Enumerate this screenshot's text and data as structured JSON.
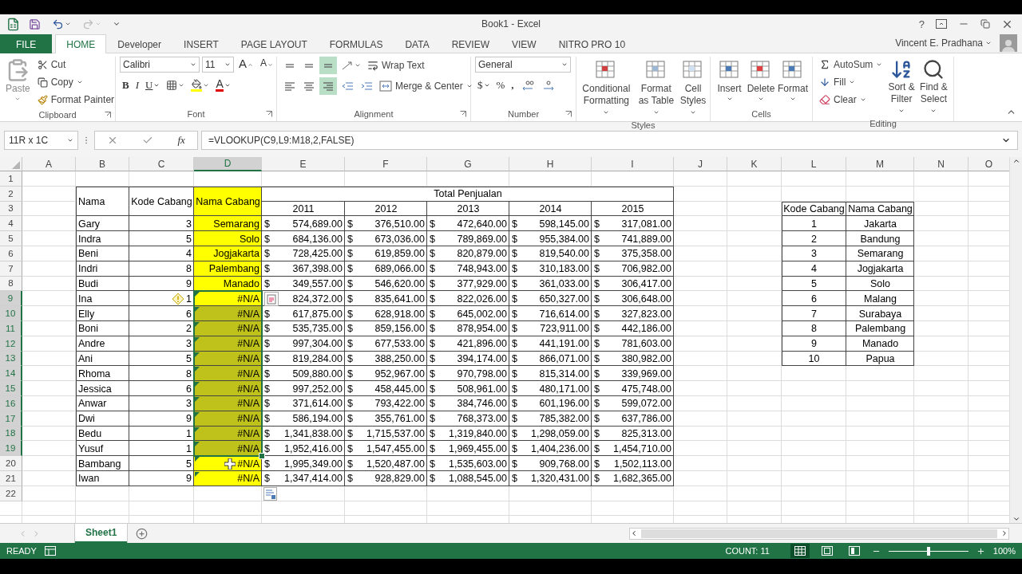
{
  "title_bar": {
    "title": "Book1 - Excel",
    "help": "?"
  },
  "ribbon_tabs": [
    {
      "label": "FILE",
      "kind": "file",
      "selected": false
    },
    {
      "label": "HOME",
      "kind": "tab",
      "selected": true
    },
    {
      "label": "Developer",
      "kind": "tab",
      "selected": false
    },
    {
      "label": "INSERT",
      "kind": "tab",
      "selected": false
    },
    {
      "label": "PAGE LAYOUT",
      "kind": "tab",
      "selected": false
    },
    {
      "label": "FORMULAS",
      "kind": "tab",
      "selected": false
    },
    {
      "label": "DATA",
      "kind": "tab",
      "selected": false
    },
    {
      "label": "REVIEW",
      "kind": "tab",
      "selected": false
    },
    {
      "label": "VIEW",
      "kind": "tab",
      "selected": false
    },
    {
      "label": "NITRO PRO 10",
      "kind": "tab",
      "selected": false
    }
  ],
  "account": {
    "name": "Vincent E. Pradhana"
  },
  "ribbon_groups": [
    {
      "kind": "clipboard",
      "label": "Clipboard",
      "items": [
        "Paste",
        "Cut",
        "Copy",
        "Format Painter"
      ]
    },
    {
      "kind": "font",
      "label": "Font",
      "font": "Calibri",
      "size": "11",
      "size_buttons": [
        "A",
        "A"
      ],
      "styles": [
        "B",
        "I",
        "U"
      ],
      "color_letter": "A"
    },
    {
      "kind": "alignment",
      "label": "Alignment",
      "items": [
        "Wrap Text",
        "Merge & Center"
      ],
      "vertical": [
        {
          "selected": false
        },
        {
          "selected": false
        },
        {
          "selected": true
        }
      ],
      "horizontal": [
        {
          "selected": false
        },
        {
          "selected": false
        },
        {
          "selected": true
        }
      ]
    },
    {
      "kind": "number",
      "label": "Number",
      "format": "General",
      "symbols": [
        "$",
        "%",
        ","
      ]
    },
    {
      "kind": "styles",
      "label": "Styles",
      "items": [
        "Conditional Formatting",
        "Format as Table",
        "Cell Styles"
      ]
    },
    {
      "kind": "cells",
      "label": "Cells",
      "items": [
        "Insert",
        "Delete",
        "Format"
      ]
    },
    {
      "kind": "editing",
      "label": "Editing",
      "items": [
        "AutoSum",
        "Fill",
        "Clear",
        "Sort & Filter",
        "Find & Select"
      ]
    }
  ],
  "formula_bar": {
    "name_box": "11R x 1C",
    "function_label": "fx",
    "formula": "=VLOOKUP(C9,L9:M18,2,FALSE)"
  },
  "columns": [
    {
      "label": "A",
      "selected": false
    },
    {
      "label": "B",
      "selected": false
    },
    {
      "label": "C",
      "selected": false
    },
    {
      "label": "D",
      "selected": true
    },
    {
      "label": "E",
      "selected": false
    },
    {
      "label": "F",
      "selected": false
    },
    {
      "label": "G",
      "selected": false
    },
    {
      "label": "H",
      "selected": false
    },
    {
      "label": "I",
      "selected": false
    },
    {
      "label": "J",
      "selected": false
    },
    {
      "label": "K",
      "selected": false
    },
    {
      "label": "L",
      "selected": false
    },
    {
      "label": "M",
      "selected": false
    },
    {
      "label": "N",
      "selected": false
    },
    {
      "label": "O",
      "selected": false
    }
  ],
  "row_headers": [
    {
      "label": "1",
      "selected": false
    },
    {
      "label": "2",
      "selected": false
    },
    {
      "label": "3",
      "selected": false
    },
    {
      "label": "4",
      "selected": false
    },
    {
      "label": "5",
      "selected": false
    },
    {
      "label": "6",
      "selected": false
    },
    {
      "label": "7",
      "selected": false
    },
    {
      "label": "8",
      "selected": false
    },
    {
      "label": "9",
      "selected": true
    },
    {
      "label": "10",
      "selected": true
    },
    {
      "label": "11",
      "selected": true
    },
    {
      "label": "12",
      "selected": true
    },
    {
      "label": "13",
      "selected": true
    },
    {
      "label": "14",
      "selected": true
    },
    {
      "label": "15",
      "selected": true
    },
    {
      "label": "16",
      "selected": true
    },
    {
      "label": "17",
      "selected": true
    },
    {
      "label": "18",
      "selected": true
    },
    {
      "label": "19",
      "selected": true
    },
    {
      "label": "20",
      "selected": false
    },
    {
      "label": "21",
      "selected": false
    },
    {
      "label": "22",
      "selected": false
    }
  ],
  "sales_table": {
    "headers": {
      "name": "Nama",
      "code": "Kode Cabang",
      "branch": "Nama Cabang",
      "group": "Total Penjualan",
      "years": [
        "2011",
        "2012",
        "2013",
        "2014",
        "2015"
      ]
    },
    "rows": [
      {
        "name": "Gary",
        "code": "3",
        "branch": "Semarang",
        "selected": false,
        "active": false,
        "warning": false,
        "error_marker": false,
        "sales": [
          [
            "$",
            "574,689.00"
          ],
          [
            "$",
            "376,510.00"
          ],
          [
            "$",
            "472,640.00"
          ],
          [
            "$",
            "598,145.00"
          ],
          [
            "$",
            "317,081.00"
          ]
        ]
      },
      {
        "name": "Indra",
        "code": "5",
        "branch": "Solo",
        "selected": false,
        "active": false,
        "warning": false,
        "error_marker": false,
        "sales": [
          [
            "$",
            "684,136.00"
          ],
          [
            "$",
            "673,036.00"
          ],
          [
            "$",
            "789,869.00"
          ],
          [
            "$",
            "955,384.00"
          ],
          [
            "$",
            "741,889.00"
          ]
        ]
      },
      {
        "name": "Beni",
        "code": "4",
        "branch": "Jogjakarta",
        "selected": false,
        "active": false,
        "warning": false,
        "error_marker": false,
        "sales": [
          [
            "$",
            "728,425.00"
          ],
          [
            "$",
            "619,859.00"
          ],
          [
            "$",
            "820,879.00"
          ],
          [
            "$",
            "819,540.00"
          ],
          [
            "$",
            "375,358.00"
          ]
        ]
      },
      {
        "name": "Indri",
        "code": "8",
        "branch": "Palembang",
        "selected": false,
        "active": false,
        "warning": false,
        "error_marker": false,
        "sales": [
          [
            "$",
            "367,398.00"
          ],
          [
            "$",
            "689,066.00"
          ],
          [
            "$",
            "748,943.00"
          ],
          [
            "$",
            "310,183.00"
          ],
          [
            "$",
            "706,982.00"
          ]
        ]
      },
      {
        "name": "Budi",
        "code": "9",
        "branch": "Manado",
        "selected": false,
        "active": false,
        "warning": false,
        "error_marker": false,
        "sales": [
          [
            "$",
            "349,557.00"
          ],
          [
            "$",
            "546,620.00"
          ],
          [
            "$",
            "377,929.00"
          ],
          [
            "$",
            "361,033.00"
          ],
          [
            "$",
            "306,417.00"
          ]
        ]
      },
      {
        "name": "Ina",
        "code": "1",
        "branch": "#N/A",
        "selected": true,
        "active": true,
        "warning": true,
        "error_marker": true,
        "sales": [
          [
            "824,372.00"
          ],
          [
            "$",
            "835,641.00"
          ],
          [
            "$",
            "822,026.00"
          ],
          [
            "$",
            "650,327.00"
          ],
          [
            "$",
            "306,648.00"
          ]
        ]
      },
      {
        "name": "Elly",
        "code": "6",
        "branch": "#N/A",
        "selected": true,
        "active": false,
        "warning": false,
        "error_marker": true,
        "sales": [
          [
            "$",
            "617,875.00"
          ],
          [
            "$",
            "628,918.00"
          ],
          [
            "$",
            "645,002.00"
          ],
          [
            "$",
            "716,614.00"
          ],
          [
            "$",
            "327,823.00"
          ]
        ]
      },
      {
        "name": "Boni",
        "code": "2",
        "branch": "#N/A",
        "selected": true,
        "active": false,
        "warning": false,
        "error_marker": true,
        "sales": [
          [
            "$",
            "535,735.00"
          ],
          [
            "$",
            "859,156.00"
          ],
          [
            "$",
            "878,954.00"
          ],
          [
            "$",
            "723,911.00"
          ],
          [
            "$",
            "442,186.00"
          ]
        ]
      },
      {
        "name": "Andre",
        "code": "3",
        "branch": "#N/A",
        "selected": true,
        "active": false,
        "warning": false,
        "error_marker": true,
        "sales": [
          [
            "$",
            "997,304.00"
          ],
          [
            "$",
            "677,533.00"
          ],
          [
            "$",
            "421,896.00"
          ],
          [
            "$",
            "441,191.00"
          ],
          [
            "$",
            "781,603.00"
          ]
        ]
      },
      {
        "name": "Ani",
        "code": "5",
        "branch": "#N/A",
        "selected": true,
        "active": false,
        "warning": false,
        "error_marker": true,
        "sales": [
          [
            "$",
            "819,284.00"
          ],
          [
            "$",
            "388,250.00"
          ],
          [
            "$",
            "394,174.00"
          ],
          [
            "$",
            "866,071.00"
          ],
          [
            "$",
            "380,982.00"
          ]
        ]
      },
      {
        "name": "Rhoma",
        "code": "8",
        "branch": "#N/A",
        "selected": true,
        "active": false,
        "warning": false,
        "error_marker": true,
        "sales": [
          [
            "$",
            "509,880.00"
          ],
          [
            "$",
            "952,967.00"
          ],
          [
            "$",
            "970,798.00"
          ],
          [
            "$",
            "815,314.00"
          ],
          [
            "$",
            "339,969.00"
          ]
        ]
      },
      {
        "name": "Jessica",
        "code": "6",
        "branch": "#N/A",
        "selected": true,
        "active": false,
        "warning": false,
        "error_marker": true,
        "sales": [
          [
            "$",
            "997,252.00"
          ],
          [
            "$",
            "458,445.00"
          ],
          [
            "$",
            "508,961.00"
          ],
          [
            "$",
            "480,171.00"
          ],
          [
            "$",
            "475,748.00"
          ]
        ]
      },
      {
        "name": "Anwar",
        "code": "3",
        "branch": "#N/A",
        "selected": true,
        "active": false,
        "warning": false,
        "error_marker": true,
        "sales": [
          [
            "$",
            "371,614.00"
          ],
          [
            "$",
            "793,422.00"
          ],
          [
            "$",
            "384,746.00"
          ],
          [
            "$",
            "601,196.00"
          ],
          [
            "$",
            "599,072.00"
          ]
        ]
      },
      {
        "name": "Dwi",
        "code": "9",
        "branch": "#N/A",
        "selected": true,
        "active": false,
        "warning": false,
        "error_marker": true,
        "sales": [
          [
            "$",
            "586,194.00"
          ],
          [
            "$",
            "355,761.00"
          ],
          [
            "$",
            "768,373.00"
          ],
          [
            "$",
            "785,382.00"
          ],
          [
            "$",
            "637,786.00"
          ]
        ]
      },
      {
        "name": "Bedu",
        "code": "1",
        "branch": "#N/A",
        "selected": true,
        "active": false,
        "warning": false,
        "error_marker": true,
        "sales": [
          [
            "$",
            "1,341,838.00"
          ],
          [
            "$",
            "1,715,537.00"
          ],
          [
            "$",
            "1,319,840.00"
          ],
          [
            "$",
            "1,298,059.00"
          ],
          [
            "$",
            "825,313.00"
          ]
        ]
      },
      {
        "name": "Yusuf",
        "code": "1",
        "branch": "#N/A",
        "selected": true,
        "active": false,
        "warning": false,
        "error_marker": true,
        "sales": [
          [
            "$",
            "1,952,416.00"
          ],
          [
            "$",
            "1,547,455.00"
          ],
          [
            "$",
            "1,969,455.00"
          ],
          [
            "$",
            "1,404,236.00"
          ],
          [
            "$",
            "1,454,710.00"
          ]
        ]
      },
      {
        "name": "Bambang",
        "code": "5",
        "branch": "#N/A",
        "selected": false,
        "active": false,
        "warning": false,
        "error_marker": true,
        "sales": [
          [
            "$",
            "1,995,349.00"
          ],
          [
            "$",
            "1,520,487.00"
          ],
          [
            "$",
            "1,535,603.00"
          ],
          [
            "$",
            "909,768.00"
          ],
          [
            "$",
            "1,502,113.00"
          ]
        ]
      },
      {
        "name": "Iwan",
        "code": "9",
        "branch": "#N/A",
        "selected": false,
        "active": false,
        "warning": false,
        "error_marker": true,
        "sales": [
          [
            "$",
            "1,347,414.00"
          ],
          [
            "$",
            "928,829.00"
          ],
          [
            "$",
            "1,088,545.00"
          ],
          [
            "$",
            "1,320,431.00"
          ],
          [
            "$",
            "1,682,365.00"
          ]
        ]
      }
    ]
  },
  "lookup_table": {
    "headers": [
      "Kode Cabang",
      "Nama Cabang"
    ],
    "rows": [
      [
        "1",
        "Jakarta"
      ],
      [
        "2",
        "Bandung"
      ],
      [
        "3",
        "Semarang"
      ],
      [
        "4",
        "Jogjakarta"
      ],
      [
        "5",
        "Solo"
      ],
      [
        "6",
        "Malang"
      ],
      [
        "7",
        "Surabaya"
      ],
      [
        "8",
        "Palembang"
      ],
      [
        "9",
        "Manado"
      ],
      [
        "10",
        "Papua"
      ]
    ]
  },
  "sheet_tabs": [
    {
      "label": "Sheet1",
      "selected": true
    }
  ],
  "status_bar": {
    "mode": "READY",
    "count": "COUNT: 11",
    "views": [
      {
        "kind": "normal",
        "selected": true
      },
      {
        "kind": "page_layout",
        "selected": false
      },
      {
        "kind": "page_break",
        "selected": false
      }
    ],
    "zoom": {
      "level": 0.5,
      "reading": "100%"
    }
  }
}
